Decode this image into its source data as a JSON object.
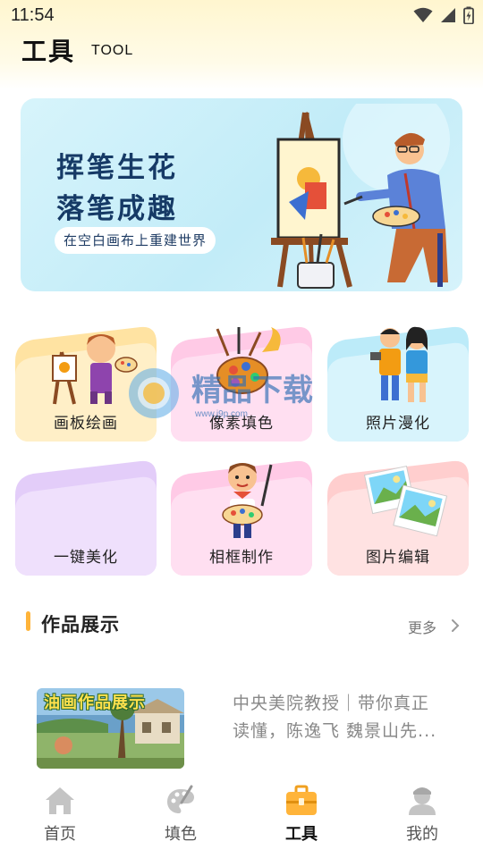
{
  "status_bar": {
    "time": "11:54"
  },
  "header": {
    "title": "工具",
    "subtitle": "TOOL"
  },
  "banner": {
    "line1": "挥笔生花",
    "line2": "落笔成趣",
    "tagline": "在空白画布上重建世界"
  },
  "tools": [
    {
      "label": "画板绘画",
      "color": "#ffe9b8"
    },
    {
      "label": "像素填色",
      "color": "#ffd9ef"
    },
    {
      "label": "照片漫化",
      "color": "#d2f1fb"
    },
    {
      "label": "一键美化",
      "color": "#ecdcfb"
    },
    {
      "label": "相框制作",
      "color": "#ffd9ef"
    },
    {
      "label": "图片编辑",
      "color": "#ffe0e0"
    }
  ],
  "watermark": {
    "text": "精品下载",
    "url": "www.j9p.com"
  },
  "section": {
    "title": "作品展示",
    "more": "更多"
  },
  "work_item": {
    "thumb_title": "油画作品展示",
    "line1": "中央美院教授｜带你真正",
    "line2": "读懂，陈逸飞 魏景山先..."
  },
  "tabbar": {
    "items": [
      {
        "label": "首页",
        "icon": "home-icon"
      },
      {
        "label": "填色",
        "icon": "palette-icon"
      },
      {
        "label": "工具",
        "icon": "toolbox-icon"
      },
      {
        "label": "我的",
        "icon": "user-icon"
      }
    ],
    "active_index": 2,
    "accent": "#ffb43a"
  }
}
